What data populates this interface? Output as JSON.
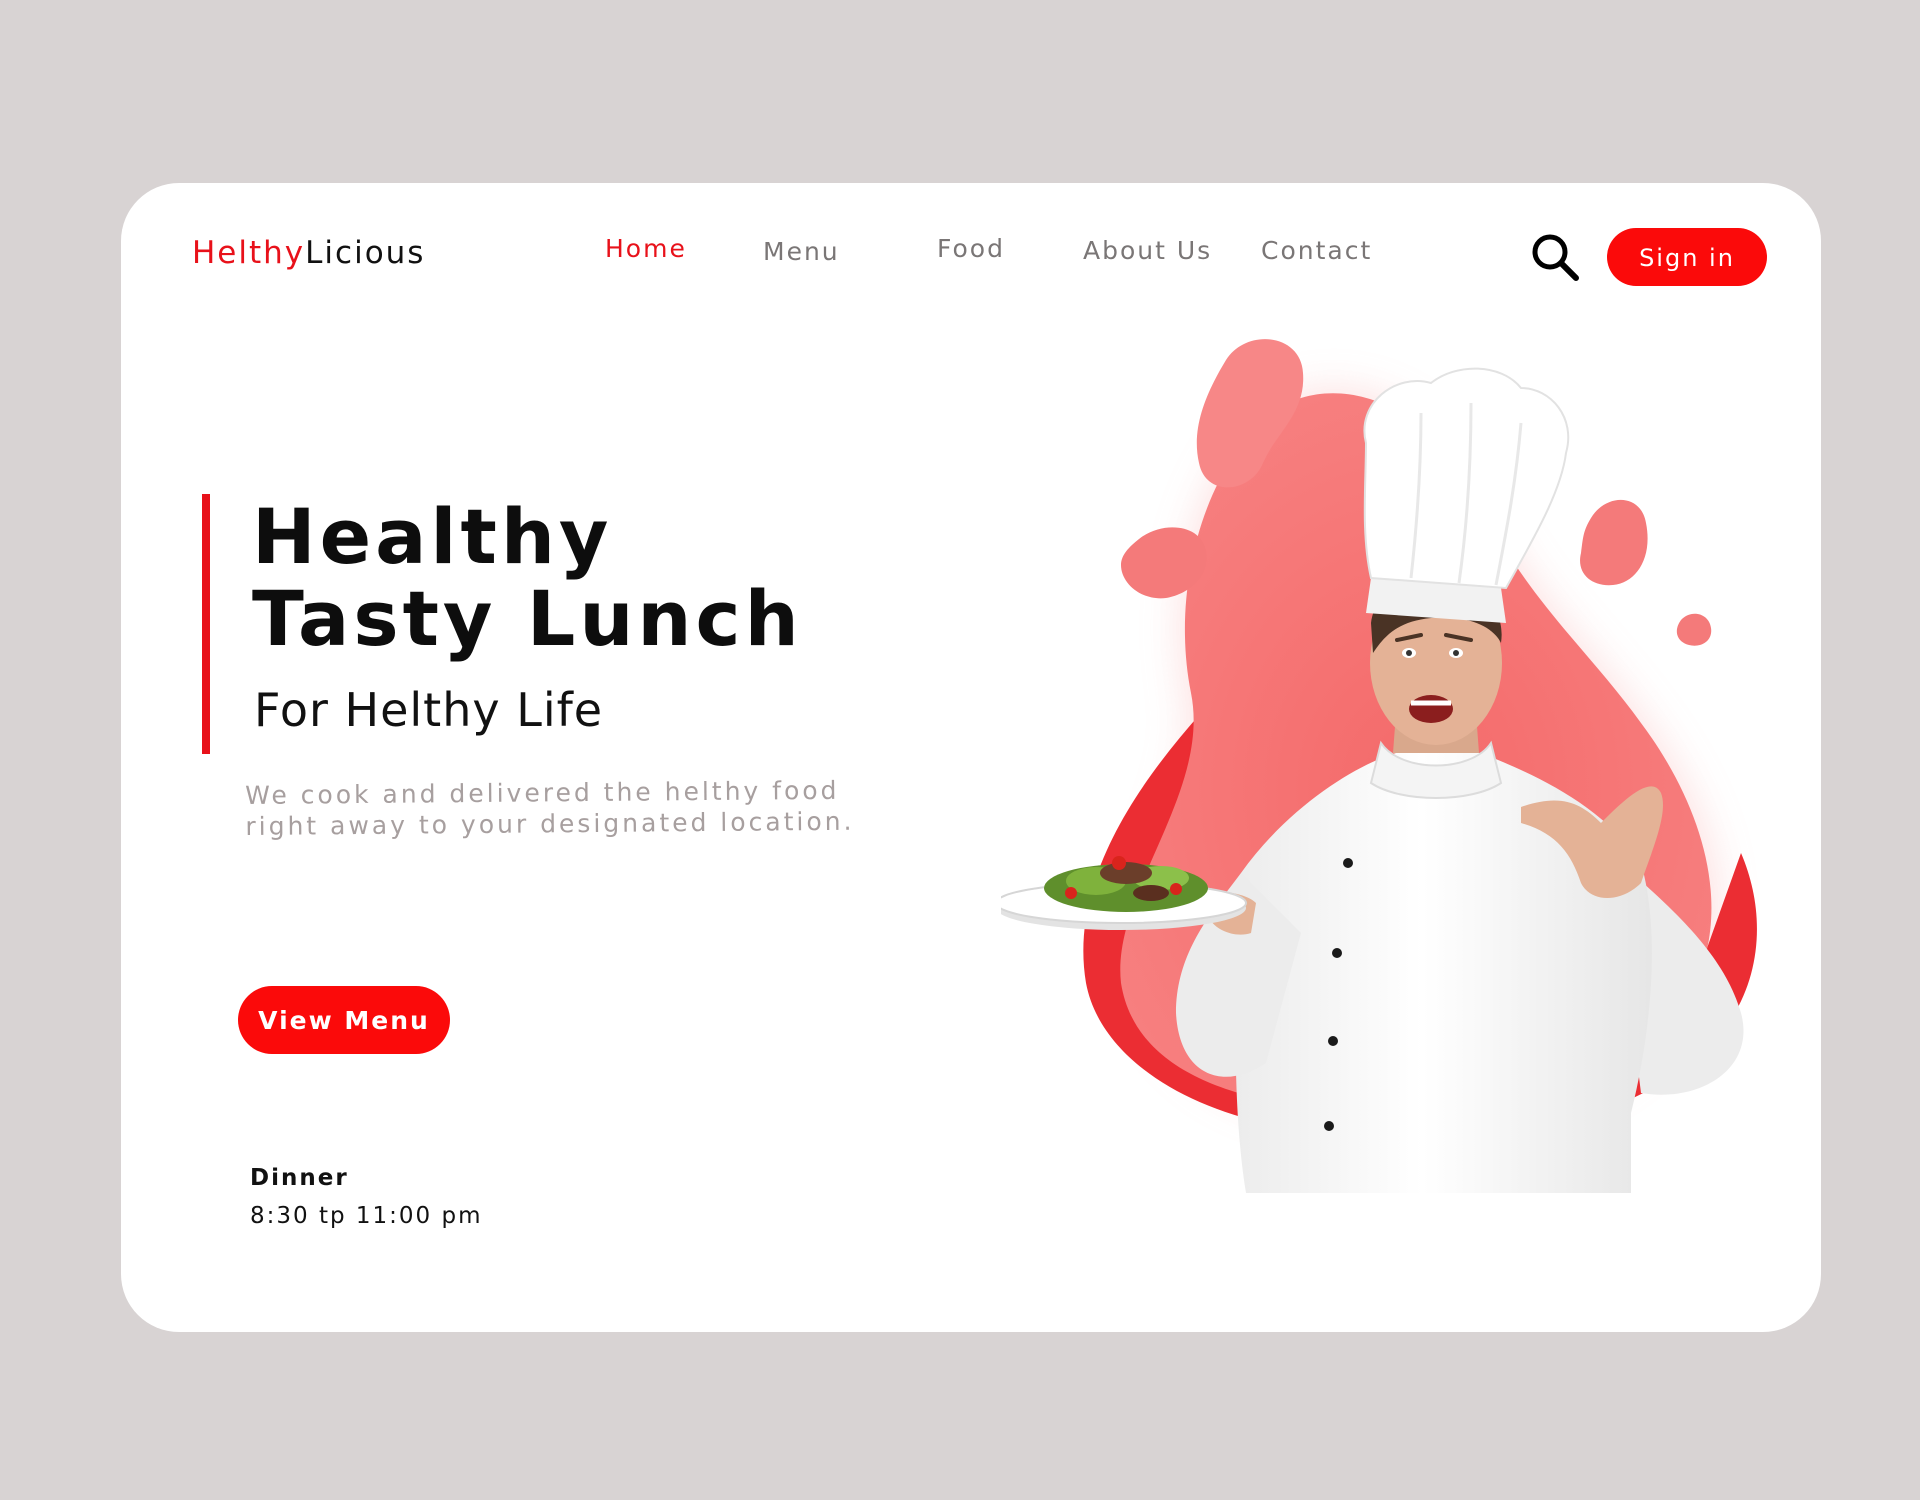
{
  "header": {
    "logo_part1": "Helthy",
    "logo_part2": "Licious",
    "nav": [
      {
        "label": "Home",
        "active": true
      },
      {
        "label": "Menu",
        "active": false
      },
      {
        "label": "Food",
        "active": false
      },
      {
        "label": "About Us",
        "active": false
      },
      {
        "label": "Contact",
        "active": false
      }
    ],
    "search_icon": "search-icon",
    "signin_label": "Sign in"
  },
  "hero": {
    "title_line1": "Healthy",
    "title_line2": "Tasty Lunch",
    "subtitle": "For Helthy Life",
    "description_line1": "We cook and delivered the helthy food",
    "description_line2": "right away to your designated location.",
    "cta_label": "View Menu"
  },
  "hours": {
    "label": "Dinner",
    "time": "8:30 tp 11:00 pm"
  },
  "colors": {
    "accent": "#e8111a",
    "button": "#fb0a0a",
    "blob": "#f57272",
    "background": "#d8d3d3",
    "nav_text": "#7a7676",
    "description_text": "#a79f9f"
  }
}
